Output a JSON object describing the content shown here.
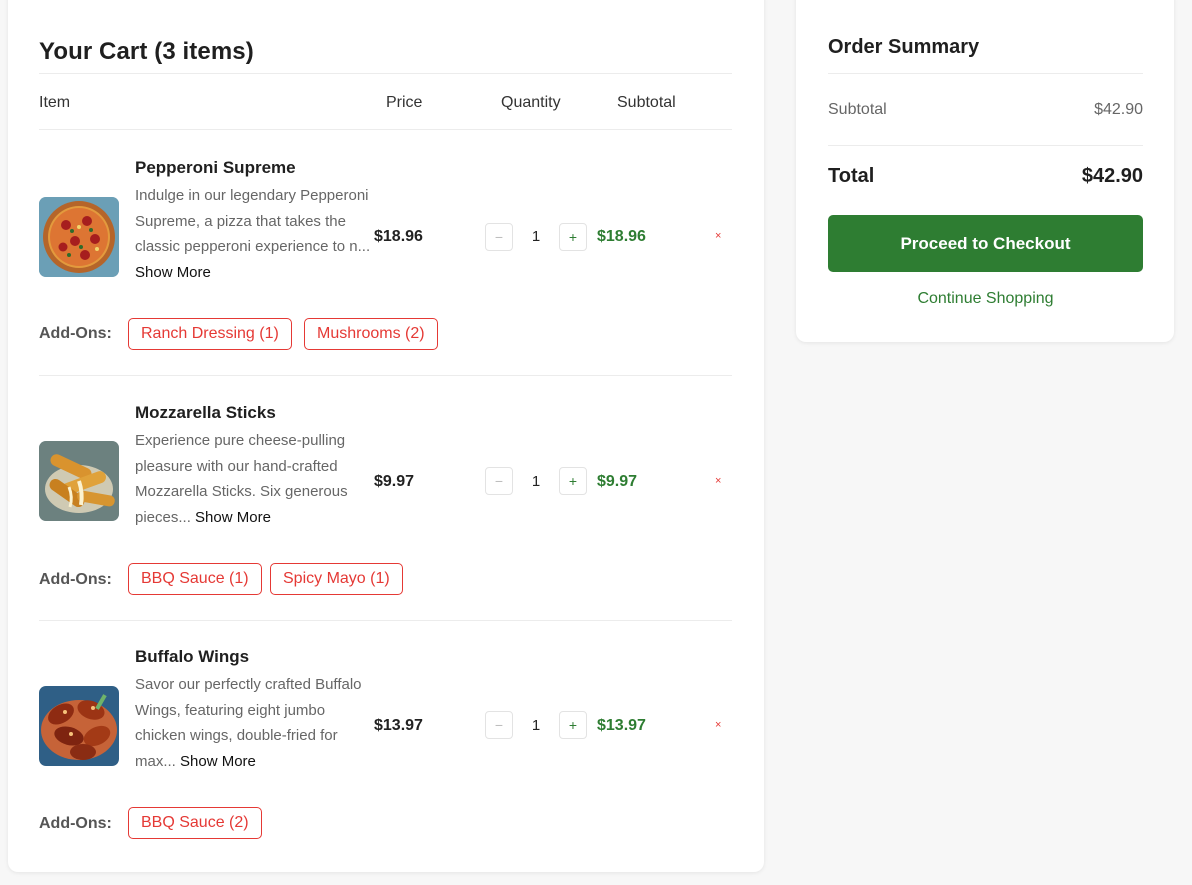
{
  "cart": {
    "title": "Your Cart (3 items)",
    "columns": {
      "item": "Item",
      "price": "Price",
      "quantity": "Quantity",
      "subtotal": "Subtotal"
    },
    "addons_label": "Add-Ons:",
    "show_more": "Show More",
    "qty_minus": "−",
    "qty_plus": "+",
    "remove": "×",
    "items": [
      {
        "name": "Pepperoni Supreme",
        "description": "Indulge in our legendary Pepperoni Supreme, a pizza that takes the classic pepperoni experience to n...",
        "price": "$18.96",
        "quantity": "1",
        "subtotal": "$18.96",
        "addons": [
          "Ranch Dressing (1)",
          "Mushrooms (2)"
        ]
      },
      {
        "name": "Mozzarella Sticks",
        "description": "Experience pure cheese-pulling pleasure with our hand-crafted Mozzarella Sticks. Six generous pieces...",
        "price": "$9.97",
        "quantity": "1",
        "subtotal": "$9.97",
        "addons": [
          "BBQ Sauce (1)",
          "Spicy Mayo (1)"
        ]
      },
      {
        "name": "Buffalo Wings",
        "description": "Savor our perfectly crafted Buffalo Wings, featuring eight jumbo chicken wings, double-fried for max...",
        "price": "$13.97",
        "quantity": "1",
        "subtotal": "$13.97",
        "addons": [
          "BBQ Sauce (2)"
        ]
      }
    ]
  },
  "summary": {
    "title": "Order Summary",
    "subtotal_label": "Subtotal",
    "subtotal_value": "$42.90",
    "total_label": "Total",
    "total_value": "$42.90",
    "checkout_label": "Proceed to Checkout",
    "continue_label": "Continue Shopping"
  },
  "colors": {
    "accent": "#2e7d32",
    "danger": "#e53935"
  }
}
